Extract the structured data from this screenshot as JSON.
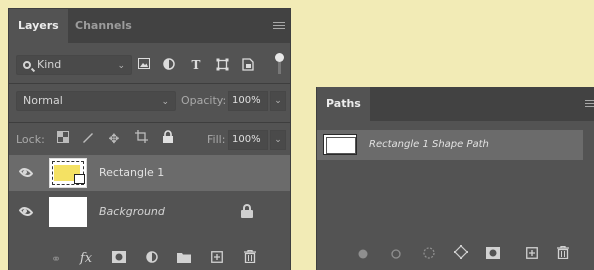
{
  "layers_panel": {
    "tabs": [
      {
        "label": "Layers",
        "active": true
      },
      {
        "label": "Channels",
        "active": false
      }
    ],
    "filter": {
      "kind_label": "Kind",
      "filter_icons": [
        "image-filter-icon",
        "adjustment-filter-icon",
        "type-filter-icon",
        "shape-filter-icon",
        "smart-object-filter-icon"
      ],
      "type_glyph": "T"
    },
    "blend_mode": "Normal",
    "opacity_label": "Opacity:",
    "opacity_value": "100%",
    "lock_label": "Lock:",
    "fill_label": "Fill:",
    "fill_value": "100%",
    "layers": [
      {
        "name": "Rectangle 1",
        "visible": true,
        "selected": true,
        "thumbnail": "shape",
        "fill_color": "#f4e163"
      },
      {
        "name": "Background",
        "visible": true,
        "selected": false,
        "thumbnail": "white",
        "locked": true
      }
    ],
    "footer_icons": [
      "link-layers-icon",
      "fx-icon",
      "layer-mask-icon",
      "adjustment-layer-icon",
      "new-group-icon",
      "new-layer-icon",
      "delete-layer-icon"
    ],
    "fx_text": "fx"
  },
  "paths_panel": {
    "tab_label": "Paths",
    "paths": [
      {
        "name": "Rectangle 1 Shape Path",
        "selected": true
      }
    ],
    "footer_icons": [
      "fill-path-icon",
      "stroke-path-icon",
      "load-selection-icon",
      "make-work-path-icon",
      "add-mask-icon",
      "new-path-icon",
      "delete-path-icon"
    ]
  },
  "colors": {
    "background": "#f2ebb6",
    "panel": "#535353",
    "tabbar": "#424242",
    "selected_row": "#6b6b6b",
    "shape_fill": "#f4e163"
  }
}
